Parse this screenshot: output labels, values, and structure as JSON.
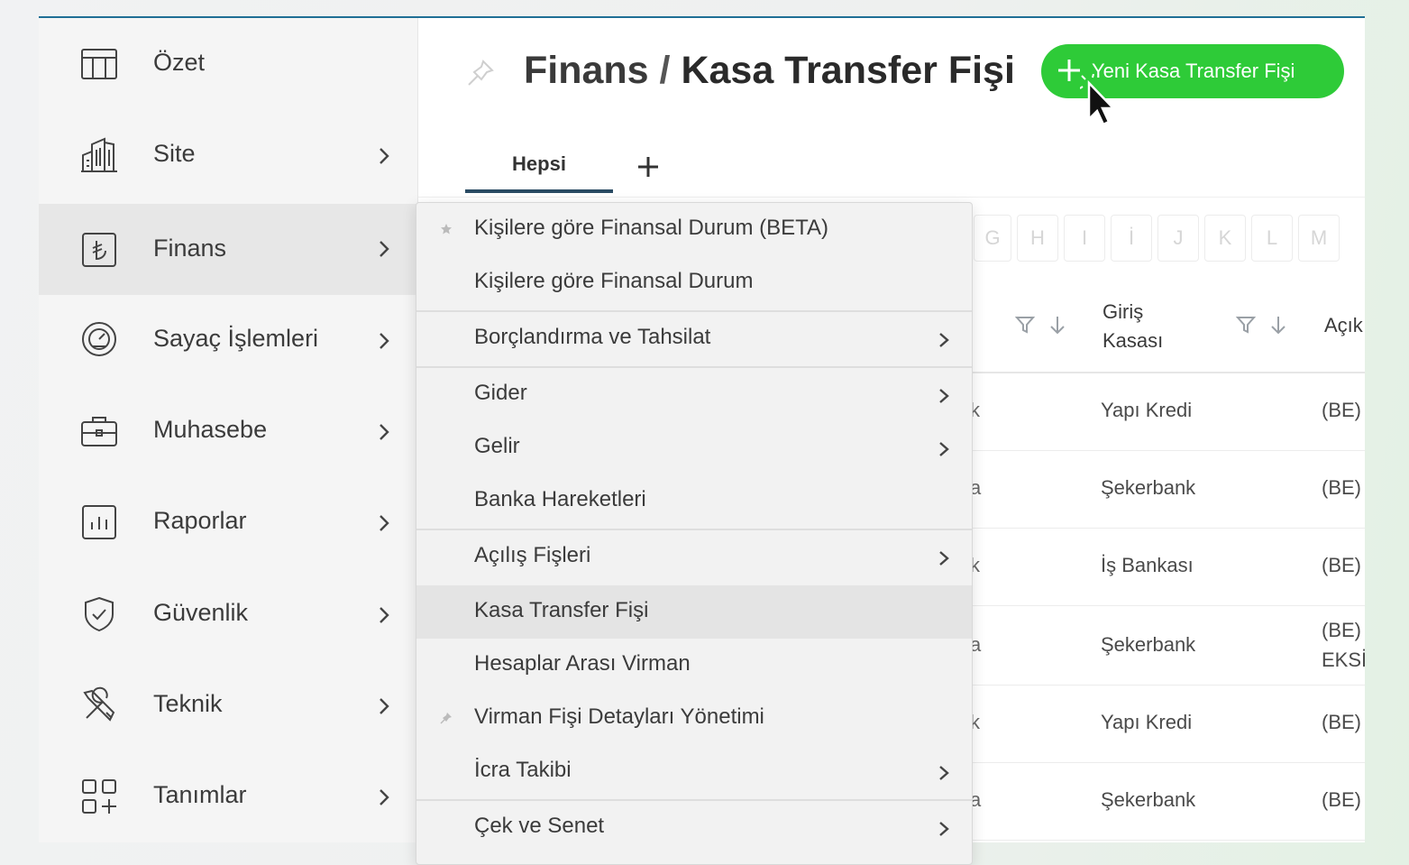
{
  "sidebar": {
    "items": [
      {
        "label": "Özet"
      },
      {
        "label": "Site"
      },
      {
        "label": "Finans"
      },
      {
        "label": "Sayaç İşlemleri"
      },
      {
        "label": "Muhasebe"
      },
      {
        "label": "Raporlar"
      },
      {
        "label": "Güvenlik"
      },
      {
        "label": "Teknik"
      },
      {
        "label": "Tanımlar"
      }
    ]
  },
  "header": {
    "breadcrumb_parent": "Finans",
    "separator": "/",
    "title": "Kasa Transfer Fişi",
    "new_button_label": "Yeni Kasa Transfer Fişi"
  },
  "tabs": {
    "active": "Hepsi"
  },
  "alphabet_filter": [
    "G",
    "H",
    "I",
    "İ",
    "J",
    "K",
    "L",
    "M"
  ],
  "table": {
    "headers": {
      "giris_kasasi": "Giriş Kasası",
      "acik": "Açık"
    },
    "rows": [
      {
        "clip": "k",
        "bank": "Yapı Kredi",
        "acik": "(BE)"
      },
      {
        "clip": "a",
        "bank": "Şekerbank",
        "acik": "(BE)"
      },
      {
        "clip": "k",
        "bank": "İş Bankası",
        "acik": "(BE)"
      },
      {
        "clip": "a",
        "bank": "Şekerbank",
        "acik": "(BE) EKSİ"
      },
      {
        "clip": "k",
        "bank": "Yapı Kredi",
        "acik": "(BE)"
      },
      {
        "clip": "a",
        "bank": "Şekerbank",
        "acik": "(BE)"
      }
    ]
  },
  "dropdown": {
    "items": [
      {
        "label": "Kişilere göre Finansal Durum (BETA)"
      },
      {
        "label": "Kişilere göre Finansal Durum"
      },
      {
        "label": "Borçlandırma ve Tahsilat"
      },
      {
        "label": "Gider"
      },
      {
        "label": "Gelir"
      },
      {
        "label": "Banka Hareketleri"
      },
      {
        "label": "Açılış Fişleri"
      },
      {
        "label": "Kasa Transfer Fişi"
      },
      {
        "label": "Hesaplar Arası Virman"
      },
      {
        "label": "Virman Fişi Detayları Yönetimi"
      },
      {
        "label": "İcra Takibi"
      },
      {
        "label": "Çek ve Senet"
      }
    ]
  },
  "colors": {
    "accent_green": "#2ecb38",
    "tab_underline": "#2a4b63",
    "top_border": "#1f6f95"
  }
}
